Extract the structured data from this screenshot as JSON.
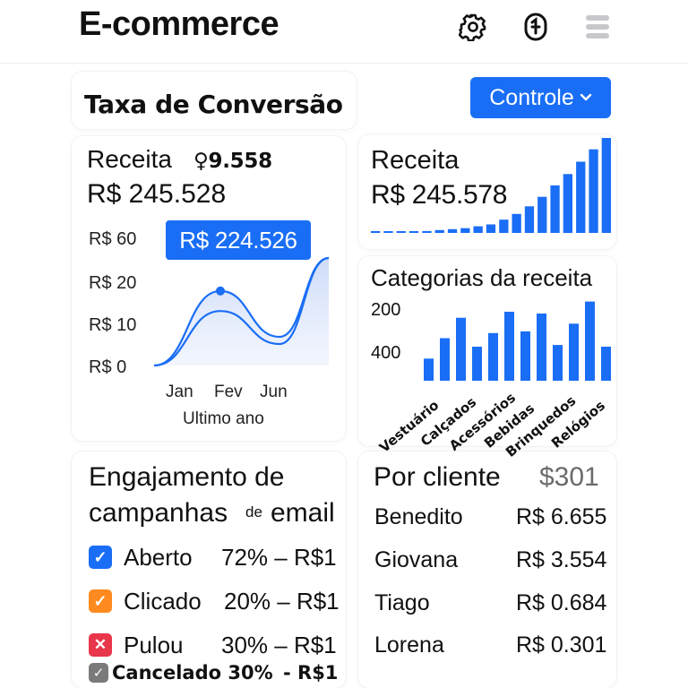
{
  "header": {
    "title": "E-commerce",
    "icons": [
      "gear-icon",
      "account-icon",
      "menu-icon"
    ]
  },
  "conversion": {
    "title": "Taxa de Conversão",
    "control_label": "Controle",
    "control_icon": "chevron-down-icon"
  },
  "revenue_card": {
    "title": "Receita",
    "badge": "♀9.558",
    "amount": "R$ 245.528",
    "tooltip": "R$ 224.526",
    "x_label": "Ultimo ano"
  },
  "chart_data": [
    {
      "type": "area",
      "y_ticks": [
        "R$ 60",
        "R$ 20",
        "R$ 10",
        "R$ 0"
      ],
      "categories": [
        "Jan",
        "Fev",
        "Jun"
      ],
      "series": [
        {
          "values": [
            0,
            52,
            20,
            75
          ]
        },
        {
          "values": [
            0,
            38,
            15,
            75
          ]
        }
      ],
      "highlight_label": "R$ 224.526",
      "xlabel": "Ultimo ano"
    },
    {
      "type": "bar",
      "values": [
        1,
        1,
        1,
        1,
        2,
        3,
        4,
        5,
        7,
        9,
        14,
        20,
        28,
        38,
        50,
        62,
        75,
        88,
        100
      ]
    },
    {
      "type": "bar",
      "y_ticks": [
        "200",
        "400"
      ],
      "categories": [
        "Vestuário",
        "Calçados",
        "Acessórios",
        "Bebidas",
        "Brinquedos",
        "Relógios"
      ],
      "values": [
        26,
        50,
        74,
        40,
        56,
        81,
        58,
        79,
        42,
        67,
        93,
        40
      ]
    }
  ],
  "revenue_card2": {
    "title": "Receita",
    "amount": "R$ 245.578"
  },
  "categories_card": {
    "title": "Categorias da receita"
  },
  "email": {
    "title_line1": "Engajamento de",
    "title_line2a": "campanhas",
    "title_line2b": "de",
    "title_line2c": "email",
    "rows": [
      {
        "label": "Aberto",
        "rest": "72% – R$1",
        "color": "#1a6ef5",
        "mark": "✓"
      },
      {
        "label": "Clicado",
        "rest": "20% – R$1",
        "color": "#ff8a1f",
        "mark": "✓"
      },
      {
        "label": "Pulou",
        "rest": "30% – R$1",
        "color": "#e8364b",
        "mark": "✕"
      }
    ],
    "extra_row": {
      "label": "Cancelado 30%",
      "rest": "-  R$1",
      "color": "#7a7a7a",
      "mark": "✓"
    }
  },
  "clients": {
    "title": "Por cliente",
    "total": "$301",
    "rows": [
      {
        "name": "Benedito",
        "value": "R$ 6.655"
      },
      {
        "name": "Giovana",
        "value": "R$ 3.554"
      },
      {
        "name": "Tiago",
        "value": "R$ 0.684"
      },
      {
        "name": "Lorena",
        "value": "R$ 0.301"
      }
    ]
  },
  "colors": {
    "accent": "#1a6ef5",
    "area_fill": "#dde7fb"
  }
}
